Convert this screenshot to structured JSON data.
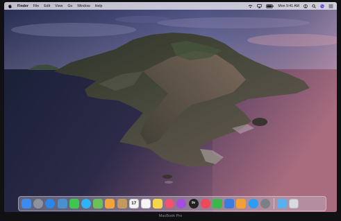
{
  "menubar": {
    "apple_icon": "apple-logo-icon",
    "items": [
      "Finder",
      "File",
      "Edit",
      "View",
      "Go",
      "Window",
      "Help"
    ],
    "clock": "Mon 9:41 AM",
    "status_icons": [
      "wifi-icon",
      "airplay-icon",
      "battery-icon",
      "user-icon",
      "spotlight-icon",
      "siri-icon",
      "control-center-icon"
    ]
  },
  "dock": {
    "apps": [
      {
        "icon": "finder-icon",
        "color": "#3c8cf0"
      },
      {
        "icon": "launchpad-icon",
        "color": "#8c939c"
      },
      {
        "icon": "safari-icon",
        "color": "#2a86e8"
      },
      {
        "icon": "photo-browser-icon",
        "color": "#4a8fd0"
      },
      {
        "icon": "facetime-icon",
        "color": "#3ec74f"
      },
      {
        "icon": "messages-icon",
        "color": "#2fb3f2"
      },
      {
        "icon": "maps-icon",
        "color": "#6cc05a"
      },
      {
        "icon": "photos-icon",
        "color": "#f2a43a"
      },
      {
        "icon": "contacts-icon",
        "color": "#c49a5c"
      },
      {
        "icon": "calendar-icon",
        "color": "#f4f4f4",
        "text": "17"
      },
      {
        "icon": "reminders-icon",
        "color": "#f5f5f5"
      },
      {
        "icon": "notes-icon",
        "color": "#f7d54a"
      },
      {
        "icon": "music-icon",
        "color": "#f0516d"
      },
      {
        "icon": "podcasts-icon",
        "color": "#a44de0"
      },
      {
        "icon": "tv-icon",
        "color": "#222222",
        "text": "tv"
      },
      {
        "icon": "news-icon",
        "color": "#f04858"
      },
      {
        "icon": "numbers-icon",
        "color": "#3bb84a"
      },
      {
        "icon": "keynote-icon",
        "color": "#3a7de0"
      },
      {
        "icon": "pages-icon",
        "color": "#f2a033"
      },
      {
        "icon": "app-store-icon",
        "color": "#2a9ef2"
      },
      {
        "icon": "system-preferences-icon",
        "color": "#7b7f86"
      }
    ],
    "extras": [
      {
        "icon": "downloads-folder-icon",
        "color": "#5ab0ef"
      },
      {
        "icon": "trash-icon",
        "color": "#d8dbe0"
      }
    ]
  },
  "device": {
    "model_label": "MacBook Pro"
  }
}
